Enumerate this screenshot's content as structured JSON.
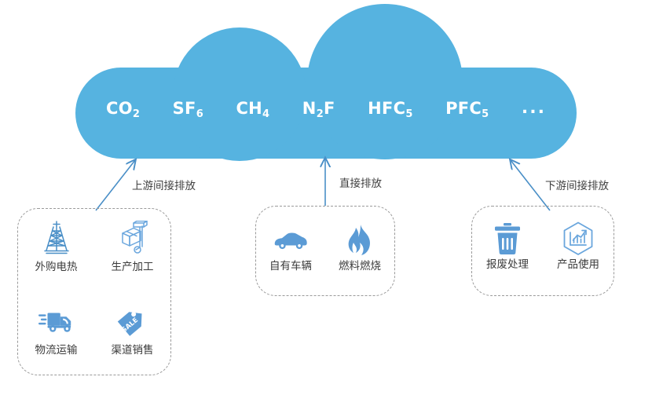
{
  "cloud": {
    "name": "greenhouse-gas-cloud",
    "fill_color": "#56b3e0",
    "gases": [
      {
        "formula": "CO",
        "sub": "2",
        "name": "gas-co2"
      },
      {
        "formula": "SF",
        "sub": "6",
        "name": "gas-sf6"
      },
      {
        "formula": "CH",
        "sub": "4",
        "name": "gas-ch4"
      },
      {
        "formula": "N",
        "sub": "2",
        "suffix": "F",
        "name": "gas-n2f"
      },
      {
        "formula": "HFC",
        "sub": "5",
        "name": "gas-hfc5"
      },
      {
        "formula": "PFC",
        "sub": "5",
        "name": "gas-pfc5"
      },
      {
        "formula": "...",
        "sub": "",
        "name": "gas-ellipsis"
      }
    ]
  },
  "arrows": {
    "upstream_label": "上游间接排放",
    "direct_label": "直接排放",
    "downstream_label": "下游间接排放",
    "color": "#4a8fc7"
  },
  "groups": [
    {
      "id": "upstream",
      "items": [
        {
          "label": "外购电热",
          "icon": "oil-derrick-icon"
        },
        {
          "label": "生产加工",
          "icon": "hand-truck-icon"
        },
        {
          "label": "物流运输",
          "icon": "delivery-truck-icon"
        },
        {
          "label": "渠道销售",
          "icon": "sale-tag-icon"
        }
      ]
    },
    {
      "id": "direct",
      "items": [
        {
          "label": "自有车辆",
          "icon": "car-icon"
        },
        {
          "label": "燃料燃烧",
          "icon": "flame-icon"
        }
      ]
    },
    {
      "id": "downstream",
      "items": [
        {
          "label": "报废处理",
          "icon": "trash-bin-icon"
        },
        {
          "label": "产品使用",
          "icon": "hexagon-chart-icon"
        }
      ]
    }
  ],
  "colors": {
    "cloud_blue": "#56b3e0",
    "icon_blue": "#5b9bd5",
    "icon_outline_blue": "#4a8fc7",
    "dash_gray": "#9a9a9a",
    "text_dark": "#3b3b3b"
  },
  "sale_tag_text": "SALE"
}
